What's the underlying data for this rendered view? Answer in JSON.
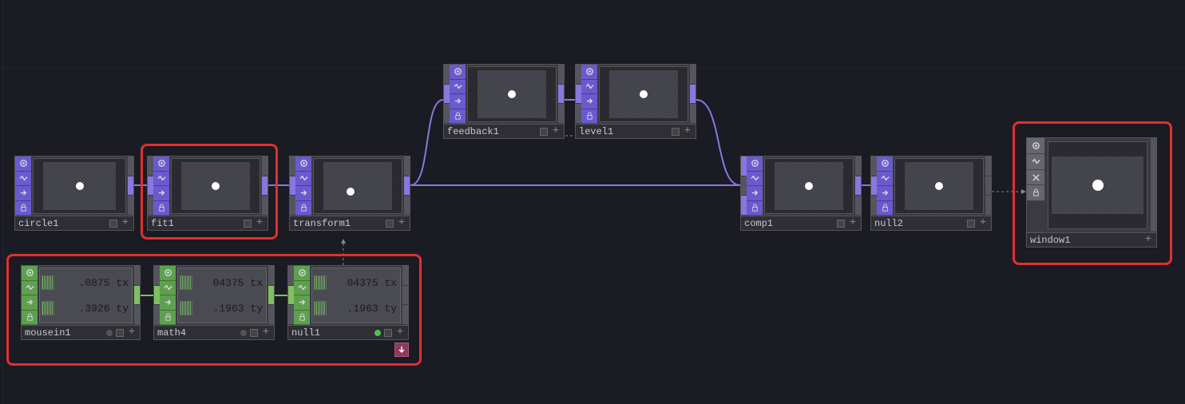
{
  "nodes": {
    "circle1": {
      "label": "circle1"
    },
    "fit1": {
      "label": "fit1"
    },
    "transform1": {
      "label": "transform1"
    },
    "feedback1": {
      "label": "feedback1"
    },
    "level1": {
      "label": "level1"
    },
    "comp1": {
      "label": "comp1"
    },
    "null2": {
      "label": "null2"
    },
    "window1": {
      "label": "window1"
    },
    "mousein1": {
      "label": "mousein1",
      "ch0_val": ".0875",
      "ch0_name": "tx",
      "ch1_val": ".3926",
      "ch1_name": "ty"
    },
    "math4": {
      "label": "math4",
      "ch0_val": "04375",
      "ch0_name": "tx",
      "ch1_val": ".1963",
      "ch1_name": "ty"
    },
    "null1": {
      "label": "null1",
      "ch0_val": "04375",
      "ch0_name": "tx",
      "ch1_val": ".1963",
      "ch1_name": "ty"
    }
  }
}
